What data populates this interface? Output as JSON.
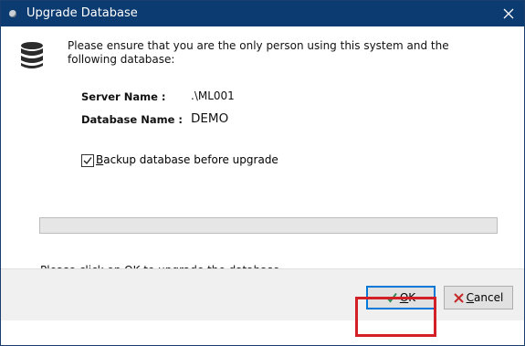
{
  "window": {
    "title": "Upgrade Database"
  },
  "intro_text": "Please ensure that you are the only person using this system and the following database:",
  "server": {
    "label": "Server Name :",
    "value": ".\\ML001"
  },
  "database": {
    "label": "Database Name :",
    "value": "DEMO"
  },
  "backup_checkbox": {
    "checked": true,
    "mnemonic": "B",
    "label_rest": "ackup database before upgrade"
  },
  "progress": {
    "value": 0
  },
  "bottom_note": "Please click on OK to upgrade the database.",
  "buttons": {
    "ok": {
      "mnemonic": "O",
      "rest": "K"
    },
    "cancel": {
      "mnemonic": "C",
      "rest": "ancel"
    }
  },
  "highlight": {
    "target": "ok-button",
    "color": "#d32027"
  },
  "colors": {
    "titlebar": "#0b3b70",
    "ok_check": "#2e8b57",
    "cancel_x": "#c62828"
  },
  "icons": [
    "app-icon",
    "close-icon",
    "database-icon",
    "checkmark-icon",
    "check-icon",
    "cross-icon"
  ]
}
